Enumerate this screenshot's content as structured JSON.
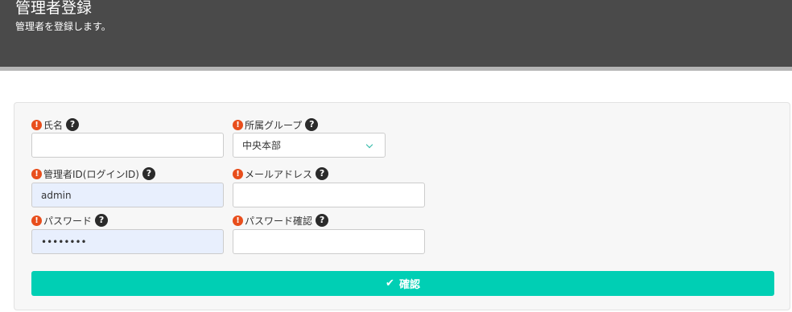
{
  "header": {
    "title": "管理者登録",
    "subtitle": "管理者を登録します。"
  },
  "form": {
    "name": {
      "label": "氏名",
      "value": ""
    },
    "group": {
      "label": "所属グループ",
      "selected": "中央本部"
    },
    "login_id": {
      "label": "管理者ID(ログインID)",
      "value": "admin"
    },
    "email": {
      "label": "メールアドレス",
      "value": ""
    },
    "password": {
      "label": "パスワード",
      "value": "••••••••"
    },
    "password_confirm": {
      "label": "パスワード確認",
      "value": ""
    },
    "required_mark": "!",
    "help_mark": "?",
    "submit_label": "確認",
    "submit_check": "✔"
  },
  "colors": {
    "header_bg": "#4a4a4a",
    "required_icon": "#e84e1c",
    "submit_button": "#00cfb4",
    "autofill_bg": "#e8effd"
  },
  "icons": {
    "required": "exclamation-circle-icon",
    "help": "question-circle-icon",
    "submit": "check-icon",
    "select": "chevron-down-icon"
  }
}
